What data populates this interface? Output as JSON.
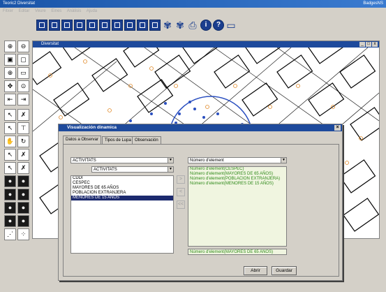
{
  "app": {
    "title": "Teoric2 Diversitat",
    "title_right": "BadgesNS"
  },
  "menu": [
    "Fitxer",
    "Editar",
    "Veure",
    "Eines",
    "Anàlisis",
    "Ajuda"
  ],
  "map_window": {
    "title": "Diversitat"
  },
  "dialog": {
    "title": "Visualización dinamica",
    "tabs": [
      "Datos a Observar",
      "Tipos de Lupa",
      "Observación"
    ],
    "active_tab": 0,
    "select_layer": "ACTIVITATS",
    "select_sublayer": "ACTIVITATS",
    "variables": [
      "CDDI",
      "CESPEC",
      "MAYORES DE 65 AÑOS",
      "POBLACION EXTRANJERA",
      "MENORES DE 15 AÑOS"
    ],
    "selected_variable_index": 4,
    "select_function": "Número d'element",
    "chosen": [
      "Número d'element(CESPEC)",
      "Número d'element(MAYORES DE 65 AÑOS)",
      "Número d'element(POBLACION EXTRANJERA)",
      "Número d'element(MENORES DE 15 AÑOS)"
    ],
    "expression": "Número d'element(MAYORES DE 65 AÑOS)",
    "add_button": ">",
    "remove_button": "<",
    "remove_all_button": "<<",
    "open_button": "Abrir",
    "save_button": "Guardar"
  },
  "colors": {
    "accent": "#1e4a9c",
    "list_green": "#2f8a1a"
  }
}
